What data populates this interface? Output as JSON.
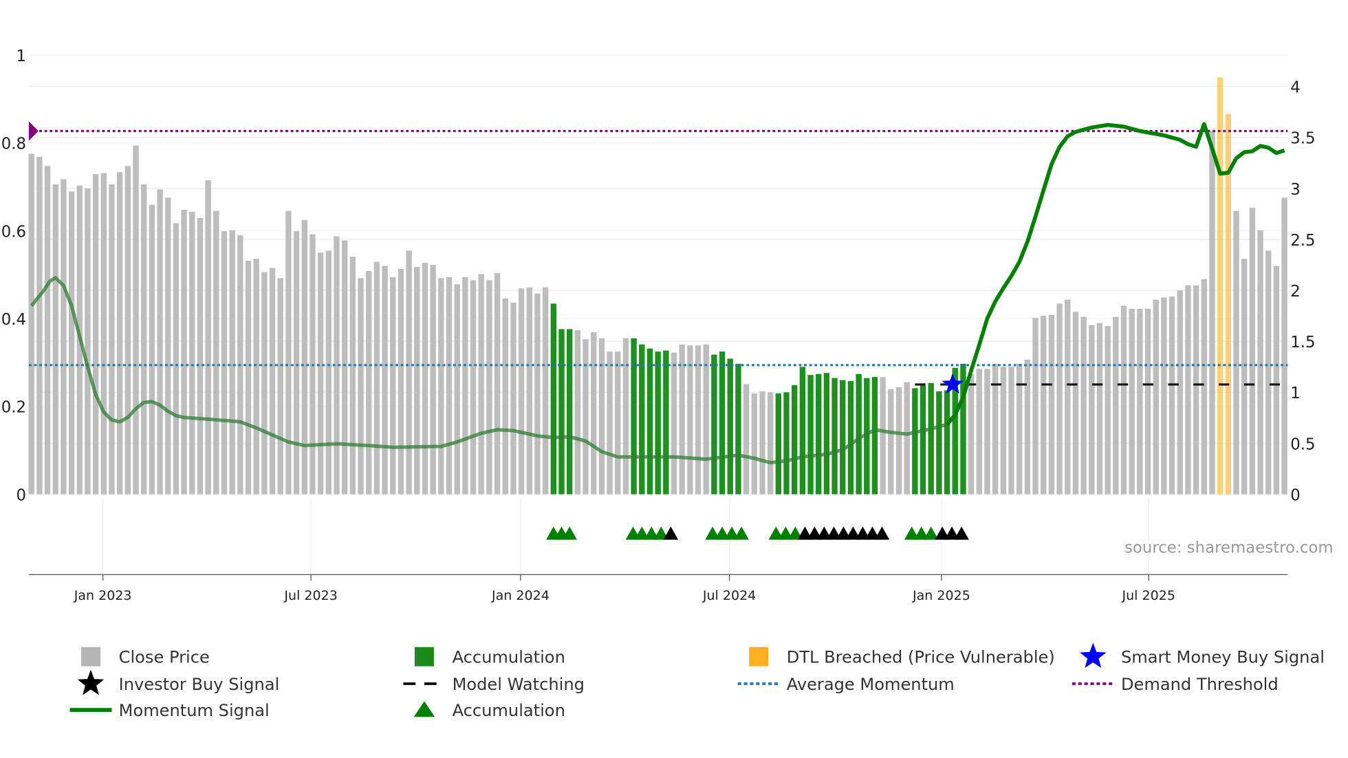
{
  "chart_data": {
    "type": "bar",
    "title": "",
    "x_ticks": [
      "Jan 2023",
      "Jul 2023",
      "Jan 2024",
      "Jul 2024",
      "Jan 2025",
      "Jul 2025"
    ],
    "x_tick_week_index": [
      8.9,
      34.8,
      60.9,
      86.9,
      113.3,
      139.1
    ],
    "y_left": {
      "ticks": [
        "0",
        "0.2",
        "0.4",
        "0.6",
        "0.8",
        "1"
      ],
      "values": [
        0,
        0.2,
        0.4,
        0.6,
        0.8,
        1
      ],
      "range": [
        0,
        1
      ]
    },
    "y_right": {
      "ticks": [
        "0",
        "0.5",
        "1",
        "1.5",
        "2",
        "2.5",
        "3",
        "3.5",
        "4"
      ],
      "values": [
        0,
        0.5,
        1,
        1.5,
        2,
        2.5,
        3,
        3.5,
        4
      ],
      "range": [
        0,
        4
      ]
    },
    "close_price": [
      3.34,
      3.31,
      3.22,
      3.04,
      3.09,
      2.97,
      3.03,
      3.0,
      3.14,
      3.15,
      3.04,
      3.16,
      3.22,
      3.42,
      3.04,
      2.84,
      2.99,
      2.91,
      2.66,
      2.79,
      2.77,
      2.71,
      3.08,
      2.78,
      2.58,
      2.59,
      2.54,
      2.29,
      2.31,
      2.18,
      2.22,
      2.12,
      2.78,
      2.58,
      2.69,
      2.55,
      2.37,
      2.39,
      2.53,
      2.49,
      2.33,
      2.12,
      2.19,
      2.28,
      2.24,
      2.13,
      2.21,
      2.39,
      2.23,
      2.27,
      2.25,
      2.12,
      2.13,
      2.06,
      2.13,
      2.1,
      2.16,
      2.1,
      2.17,
      1.92,
      1.88,
      2.02,
      2.03,
      1.97,
      2.03,
      1.87,
      1.62,
      1.62,
      1.61,
      1.52,
      1.59,
      1.53,
      1.4,
      1.4,
      1.53,
      1.53,
      1.47,
      1.43,
      1.4,
      1.41,
      1.39,
      1.47,
      1.46,
      1.46,
      1.47,
      1.37,
      1.4,
      1.33,
      1.28,
      1.08,
      0.99,
      1.01,
      1.0,
      0.99,
      1.0,
      1.07,
      1.25,
      1.17,
      1.18,
      1.19,
      1.14,
      1.12,
      1.11,
      1.18,
      1.14,
      1.15,
      1.15,
      1.03,
      1.05,
      1.1,
      1.04,
      1.07,
      1.09,
      1.01,
      1.02,
      1.24,
      1.28,
      1.18,
      1.23,
      1.23,
      1.28,
      1.25,
      1.25,
      1.28,
      1.32,
      1.73,
      1.75,
      1.76,
      1.87,
      1.91,
      1.79,
      1.74,
      1.66,
      1.68,
      1.65,
      1.74,
      1.85,
      1.82,
      1.82,
      1.82,
      1.91,
      1.93,
      1.94,
      2.0,
      2.05,
      2.05,
      2.11,
      3.56,
      4.09,
      3.73,
      2.78,
      2.31,
      2.81,
      2.59,
      2.39,
      2.24,
      2.91
    ],
    "accumulation_ranges": [
      [
        65,
        67
      ],
      [
        75,
        79
      ],
      [
        85,
        88
      ],
      [
        93,
        105
      ],
      [
        110,
        116
      ]
    ],
    "dtl_breached_ranges": [
      [
        148,
        149
      ]
    ],
    "momentum_signal": {
      "week_index": [
        0,
        1.5,
        2.3,
        3,
        4,
        5,
        6,
        7,
        8,
        9,
        10,
        11,
        12,
        13,
        14,
        15,
        16,
        17,
        18,
        19,
        22,
        26,
        28,
        30,
        32,
        34,
        38,
        42,
        45,
        51,
        53,
        56,
        58,
        60,
        63,
        65,
        67,
        69,
        71,
        73,
        77,
        80,
        84,
        88,
        90,
        92,
        94,
        96,
        99,
        101,
        103,
        105,
        107,
        109,
        112,
        114,
        115,
        116,
        117,
        118,
        119,
        120,
        121,
        122,
        123,
        124,
        125,
        126,
        127,
        128,
        129,
        130,
        132,
        134,
        136,
        138,
        141,
        143,
        144,
        145,
        146,
        147,
        148,
        149,
        150,
        151,
        152,
        153,
        154,
        155,
        156
      ],
      "values": [
        0.429,
        0.463,
        0.485,
        0.493,
        0.475,
        0.429,
        0.36,
        0.29,
        0.227,
        0.187,
        0.169,
        0.165,
        0.175,
        0.195,
        0.209,
        0.211,
        0.203,
        0.189,
        0.179,
        0.175,
        0.171,
        0.165,
        0.151,
        0.135,
        0.119,
        0.111,
        0.115,
        0.111,
        0.107,
        0.109,
        0.119,
        0.139,
        0.147,
        0.145,
        0.133,
        0.129,
        0.131,
        0.121,
        0.097,
        0.085,
        0.085,
        0.085,
        0.08,
        0.089,
        0.082,
        0.072,
        0.076,
        0.085,
        0.091,
        0.101,
        0.127,
        0.147,
        0.141,
        0.137,
        0.149,
        0.159,
        0.181,
        0.221,
        0.282,
        0.34,
        0.4,
        0.439,
        0.469,
        0.497,
        0.529,
        0.575,
        0.632,
        0.692,
        0.751,
        0.791,
        0.815,
        0.825,
        0.835,
        0.841,
        0.837,
        0.827,
        0.817,
        0.807,
        0.797,
        0.791,
        0.843,
        0.787,
        0.73,
        0.732,
        0.765,
        0.779,
        0.781,
        0.793,
        0.789,
        0.777,
        0.783
      ],
      "faded_until_index": 115
    },
    "average_momentum": 0.294,
    "demand_threshold": 0.827,
    "model_watching": {
      "value": 0.25,
      "start_index": 110,
      "end_index": 156
    },
    "smart_money_buy_signal": {
      "index": 116,
      "value": 0.25
    },
    "accumulation_triangles": [
      65,
      66,
      67,
      74.9,
      76,
      77.2,
      78.4,
      84.8,
      86,
      87.2,
      88.4,
      92.7,
      93.9,
      95.1,
      109.6,
      110.8,
      112
    ],
    "investor_buy_triangles": [
      79.6,
      96.3,
      97.5,
      98.7,
      99.9,
      101.1,
      102.3,
      103.5,
      104.7,
      105.9,
      113.4,
      114.6,
      115.8
    ],
    "colors": {
      "close": "#bdbdbd",
      "accumulation": "#1f8f1f",
      "dtl": "#ffb020",
      "momentum": "#008000",
      "average": "#1f77b4",
      "threshold": "#800080",
      "smart_money": "#0000ff",
      "investor": "#000000"
    },
    "source": "source: sharemaestro.com",
    "legend": [
      {
        "label": "Close Price",
        "symbol": "square",
        "color": "#b5b5b5"
      },
      {
        "label": "Accumulation",
        "symbol": "square",
        "color": "#1a8a1a"
      },
      {
        "label": "DTL Breached (Price Vulnerable)",
        "symbol": "square",
        "color": "#ffb020"
      },
      {
        "label": "Smart Money Buy Signal",
        "symbol": "star",
        "color": "#0000ff"
      },
      {
        "label": "Investor Buy Signal",
        "symbol": "star",
        "color": "#000000"
      },
      {
        "label": "Model Watching",
        "symbol": "dash",
        "color": "#000000"
      },
      {
        "label": "Average Momentum",
        "symbol": "dot",
        "color": "#1f77b4"
      },
      {
        "label": "Demand Threshold",
        "symbol": "dot",
        "color": "#800080"
      },
      {
        "label": "Momentum Signal",
        "symbol": "line",
        "color": "#008000"
      },
      {
        "label": "Accumulation",
        "symbol": "triangle",
        "color": "#008000"
      }
    ]
  }
}
